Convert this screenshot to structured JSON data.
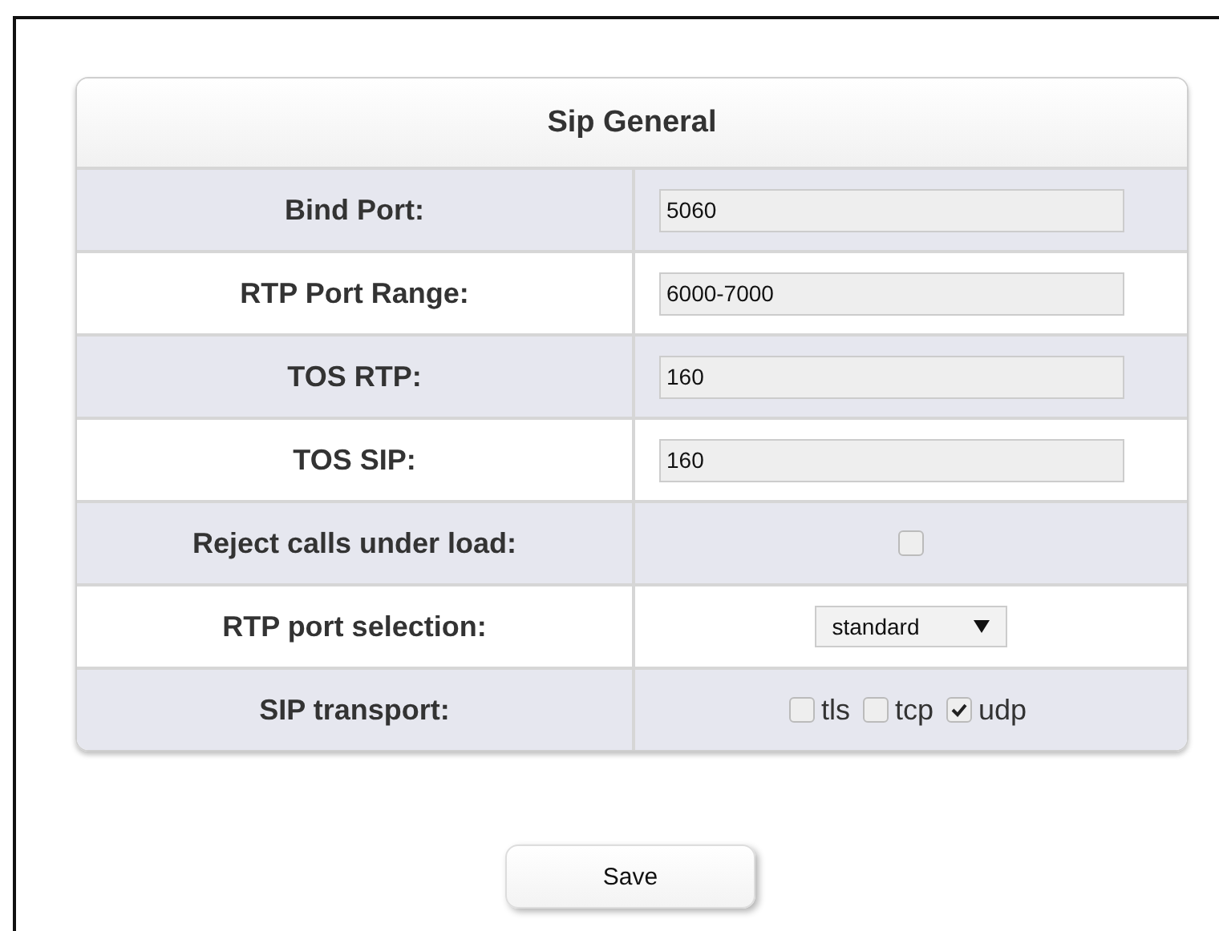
{
  "panel": {
    "title": "Sip General",
    "rows": [
      {
        "kind": "text",
        "label": "Bind Port:",
        "value": "5060"
      },
      {
        "kind": "text",
        "label": "RTP Port Range:",
        "value": "6000-7000"
      },
      {
        "kind": "text",
        "label": "TOS RTP:",
        "value": "160"
      },
      {
        "kind": "text",
        "label": "TOS SIP:",
        "value": "160"
      },
      {
        "kind": "checkbox",
        "label": "Reject calls under load:",
        "checked": false
      },
      {
        "kind": "select",
        "label": "RTP port selection:",
        "value": "standard"
      },
      {
        "kind": "checkgroup",
        "label": "SIP transport:",
        "options": [
          {
            "label": "tls",
            "checked": false
          },
          {
            "label": "tcp",
            "checked": false
          },
          {
            "label": "udp",
            "checked": true
          }
        ]
      }
    ]
  },
  "buttons": [
    "Save"
  ]
}
